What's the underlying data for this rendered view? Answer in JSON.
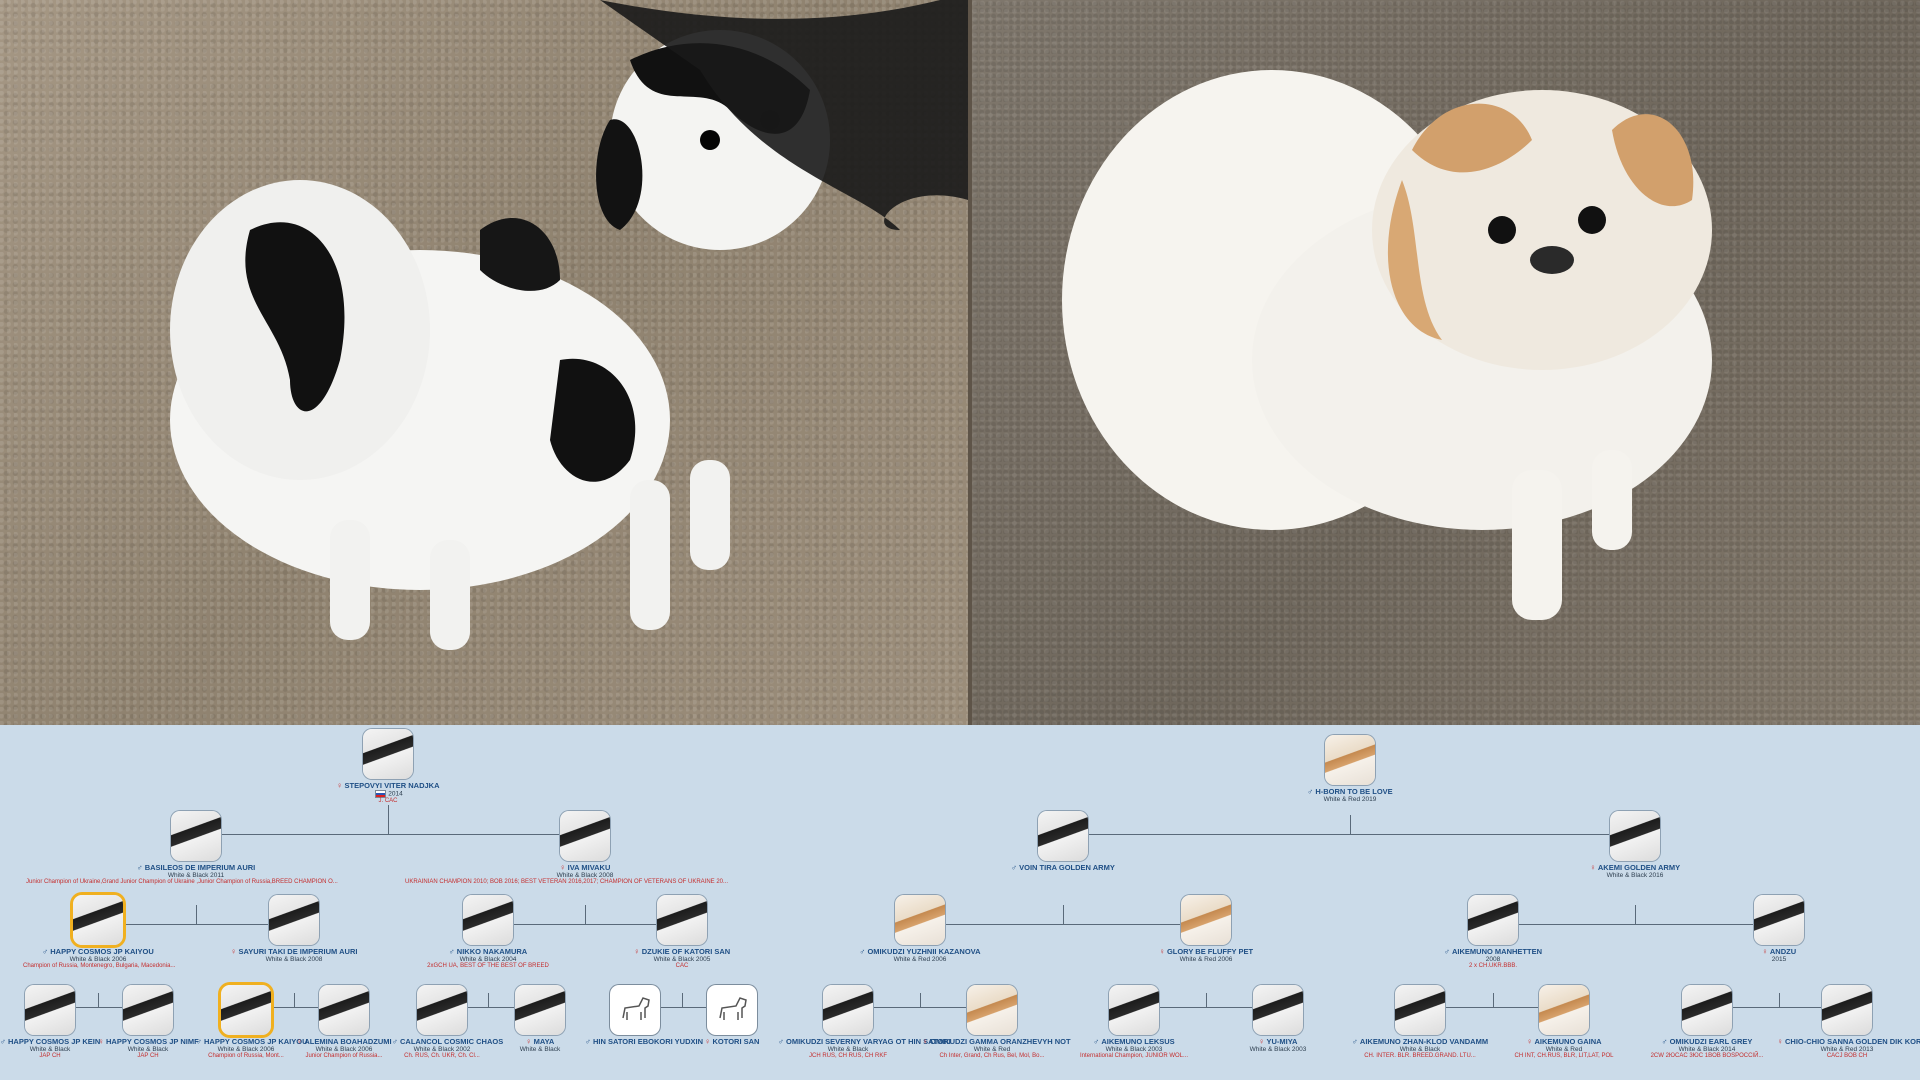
{
  "photos": {
    "left": {
      "icon": "black-white-japanese-chin-photo"
    },
    "right": {
      "icon": "red-white-japanese-chin-photo"
    }
  },
  "left_pedigree": {
    "root": {
      "name": "STEPOVYI VITER NADJKA",
      "sex": "♀",
      "meta": "2014",
      "title": "J. CAC"
    },
    "gen1": [
      {
        "name": "BASILEOS DE IMPERIUM AURI",
        "sex": "♂",
        "meta": "White & Black 2011",
        "title": "Junior Champion of Ukraine,Grand Junior Champion of Ukraine ,Junior Champion of Russia,BREED CHAMPION O..."
      },
      {
        "name": "IVA MIVAKU",
        "sex": "♀",
        "meta": "White & Black 2008",
        "title": "UKRAINIAN CHAMPION 2010; BOB 2016; BEST VETERAN 2016,2017; CHAMPION OF VETERANS OF UKRAINE 20..."
      }
    ],
    "gen2": [
      {
        "name": "HAPPY COSMOS JP KAIYOU",
        "sex": "♂",
        "meta": "White & Black 2006",
        "title": "Champion of Russia, Montenegro, Bulgaria, Macedonia..."
      },
      {
        "name": "SAYURI TAKI DE IMPERIUM AURI",
        "sex": "♀",
        "meta": "White & Black 2008",
        "title": ""
      },
      {
        "name": "NIKKO NAKAMURA",
        "sex": "♂",
        "meta": "White & Black 2004",
        "title": "2xGCH UA, BEST OF THE BEST OF BREED"
      },
      {
        "name": "DZUKIE OF KATORI SAN",
        "sex": "♀",
        "meta": "White & Black 2005",
        "title": "CAC"
      }
    ],
    "gen3": [
      {
        "name": "HAPPY COSMOS JP KEIN",
        "sex": "♂",
        "meta": "White & Black",
        "title": "JAP CH"
      },
      {
        "name": "HAPPY COSMOS JP NIMF",
        "sex": "♀",
        "meta": "White & Black",
        "title": "JAP CH"
      },
      {
        "name": "HAPPY COSMOS JP KAIYOU",
        "sex": "♂",
        "meta": "White & Black 2006",
        "title": "Champion of Russia, Mont..."
      },
      {
        "name": "ALEMINA BOAHADZUMI",
        "sex": "♀",
        "meta": "White & Black 2006",
        "title": "Junior Champion of Russia..."
      },
      {
        "name": "CALANCOL COSMIC CHAOS",
        "sex": "♂",
        "meta": "White & Black 2002",
        "title": "Ch. RUS, Ch. UKR, Ch. Cl..."
      },
      {
        "name": "MAYA",
        "sex": "♀",
        "meta": "White & Black",
        "title": ""
      },
      {
        "name": "HIN SATORI EBOKORI YUDXIN",
        "sex": "♂",
        "meta": "",
        "title": ""
      },
      {
        "name": "KOTORI SAN",
        "sex": "♀",
        "meta": "",
        "title": ""
      }
    ]
  },
  "right_pedigree": {
    "root": {
      "name": "H-BORN TO BE LOVE",
      "sex": "♂",
      "meta": "White & Red 2019",
      "title": ""
    },
    "gen1": [
      {
        "name": "VOIN TIRA GOLDEN ARMY",
        "sex": "♂",
        "meta": "",
        "title": ""
      },
      {
        "name": "AKEMI GOLDEN ARMY",
        "sex": "♀",
        "meta": "White & Black 2016",
        "title": ""
      }
    ],
    "gen2": [
      {
        "name": "OMIKUDZI YUZHNII KAZANOVA",
        "sex": "♂",
        "meta": "White & Red 2006",
        "title": ""
      },
      {
        "name": "GLORY BE FLUFFY PET",
        "sex": "♀",
        "meta": "White & Red 2006",
        "title": ""
      },
      {
        "name": "AIKEMUNO MANHETTEN",
        "sex": "♂",
        "meta": "2008",
        "title": "2 x CH.UKR.BBB."
      },
      {
        "name": "ANDZU",
        "sex": "♀",
        "meta": "2015",
        "title": ""
      }
    ],
    "gen3": [
      {
        "name": "OMIKUDZI SEVERNY VARYAG OT HIN SATORI",
        "sex": "♂",
        "meta": "White & Black",
        "title": "JCH RUS, CH RUS, CH RKF"
      },
      {
        "name": "OMIKUDZI GAMMA ORANZHEVYH NOT",
        "sex": "♀",
        "meta": "White & Red",
        "title": "Ch Inter, Grand, Ch Rus, Bel, Mol, Bo..."
      },
      {
        "name": "AIKEMUNO LEKSUS",
        "sex": "♂",
        "meta": "White & Black 2003",
        "title": "International Champion, JUNIOR WOL..."
      },
      {
        "name": "YU-MIYA",
        "sex": "♀",
        "meta": "White & Black 2003",
        "title": ""
      },
      {
        "name": "AIKEMUNO ZHAN-KLOD VANDAMM",
        "sex": "♂",
        "meta": "White & Black",
        "title": "CH. INTER. BLR. BREED.GRAND. LTU..."
      },
      {
        "name": "AIKEMUNO GAINA",
        "sex": "♀",
        "meta": "White & Red",
        "title": "CH INT, CH.RUS, BLR, LIT,LAT, POL"
      },
      {
        "name": "OMIKUDZI EARL GREY",
        "sex": "♂",
        "meta": "White & Black 2014",
        "title": "2CW 2ЮCAC 3ЮC 1BOB BOSPOCCIЙ..."
      },
      {
        "name": "CHIO-CHIO SANNA GOLDEN DIK KOR",
        "sex": "♀",
        "meta": "White & Red 2013",
        "title": "CACJ BOB CH"
      }
    ]
  }
}
